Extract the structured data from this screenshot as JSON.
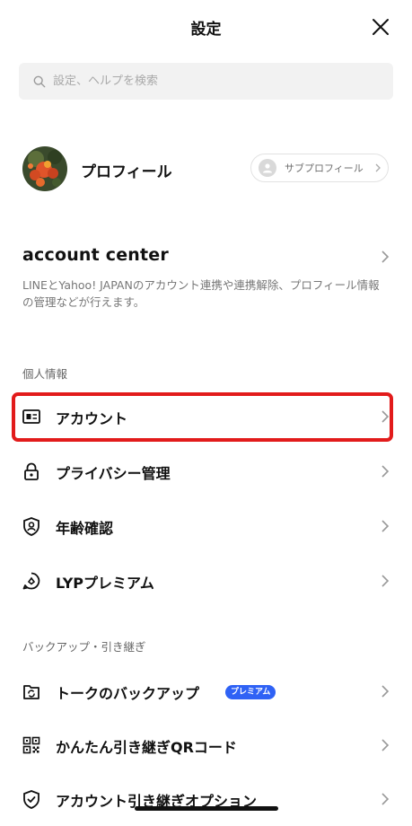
{
  "header": {
    "title": "設定"
  },
  "search": {
    "placeholder": "設定、ヘルプを検索"
  },
  "profile": {
    "name": "プロフィール",
    "subprofile_label": "サブプロフィール"
  },
  "account_center": {
    "title": "account center",
    "description": "LINEとYahoo! JAPANのアカウント連携や連携解除、プロフィール情報の管理などが行えます。"
  },
  "sections": {
    "personal": {
      "label": "個人情報",
      "items": [
        {
          "label": "アカウント",
          "icon": "id-card-icon"
        },
        {
          "label": "プライバシー管理",
          "icon": "lock-icon"
        },
        {
          "label": "年齢確認",
          "icon": "age-verify-icon"
        },
        {
          "label": "LYPプレミアム",
          "icon": "premium-icon"
        }
      ]
    },
    "backup": {
      "label": "バックアップ・引き継ぎ",
      "items": [
        {
          "label": "トークのバックアップ",
          "icon": "backup-icon",
          "badge": "プレミアム"
        },
        {
          "label": "かんたん引き継ぎQRコード",
          "icon": "qr-code-icon"
        },
        {
          "label": "アカウント引き継ぎオプション",
          "icon": "shield-check-icon"
        }
      ]
    }
  },
  "colors": {
    "highlight": "#e21b1b",
    "premium_badge": "#2f62f5"
  }
}
